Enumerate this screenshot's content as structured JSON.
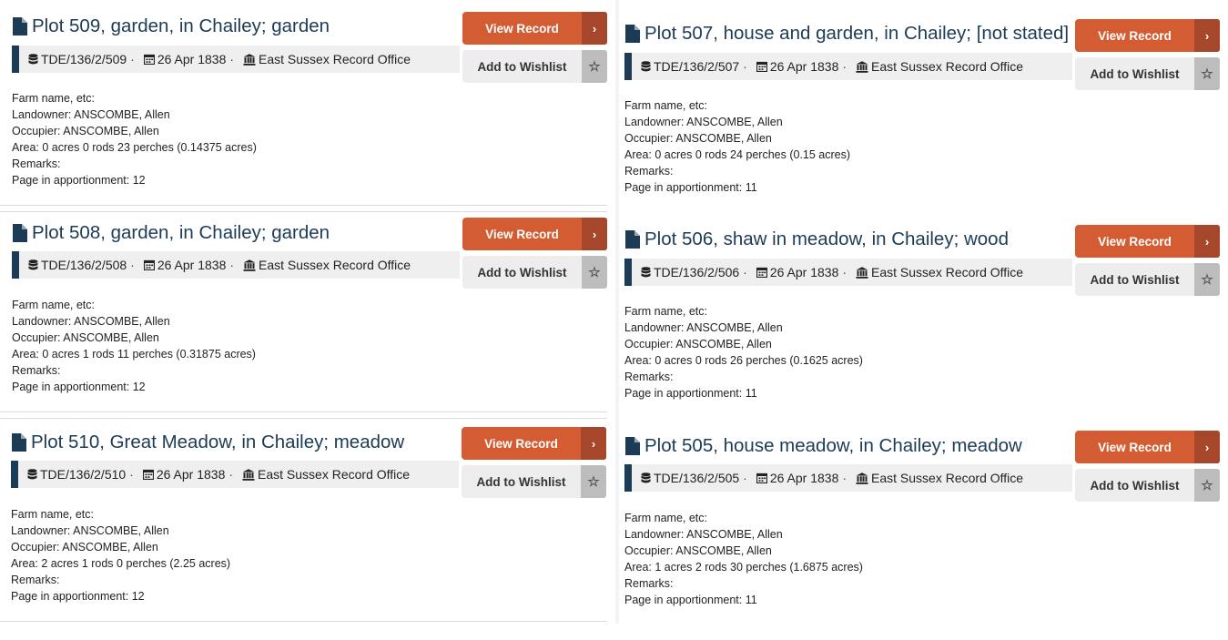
{
  "labels": {
    "view_record": "View Record",
    "add_to_wishlist": "Add to Wishlist",
    "chevron": "›",
    "star": "☆",
    "separator": "·"
  },
  "colors": {
    "title": "#1c3b57",
    "view_button": "#d45c33",
    "view_button_chevron": "#a6462a",
    "wishlist_button": "#ededed",
    "meta_bar_accent": "#1c3b57"
  },
  "icons": {
    "title": "document-icon",
    "reference": "database-icon",
    "date": "calendar-icon",
    "repository": "institution-icon"
  },
  "records": [
    {
      "title": "Plot 509, garden, in Chailey; garden",
      "reference": "TDE/136/2/509",
      "date": "26 Apr 1838",
      "repository": "East Sussex Record Office",
      "farm_name": "Farm name, etc:",
      "landowner": "Landowner: ANSCOMBE, Allen",
      "occupier": "Occupier: ANSCOMBE, Allen",
      "area": "Area: 0 acres 0 rods 23 perches (0.14375 acres)",
      "remarks": "Remarks:",
      "page": "Page in apportionment: 12"
    },
    {
      "title": "Plot 508, garden, in Chailey; garden",
      "reference": "TDE/136/2/508",
      "date": "26 Apr 1838",
      "repository": "East Sussex Record Office",
      "farm_name": "Farm name, etc:",
      "landowner": "Landowner: ANSCOMBE, Allen",
      "occupier": "Occupier: ANSCOMBE, Allen",
      "area": "Area: 0 acres 1 rods 11 perches (0.31875 acres)",
      "remarks": "Remarks:",
      "page": "Page in apportionment: 12"
    },
    {
      "title": "Plot 510, Great Meadow, in Chailey; meadow",
      "reference": "TDE/136/2/510",
      "date": "26 Apr 1838",
      "repository": "East Sussex Record Office",
      "farm_name": "Farm name, etc:",
      "landowner": "Landowner: ANSCOMBE, Allen",
      "occupier": "Occupier: ANSCOMBE, Allen",
      "area": "Area: 2 acres 1 rods 0 perches (2.25 acres)",
      "remarks": "Remarks:",
      "page": "Page in apportionment: 12"
    },
    {
      "title": "Plot 507, house and garden, in Chailey; [not stated]",
      "reference": "TDE/136/2/507",
      "date": "26 Apr 1838",
      "repository": "East Sussex Record Office",
      "farm_name": "Farm name, etc:",
      "landowner": "Landowner: ANSCOMBE, Allen",
      "occupier": "Occupier: ANSCOMBE, Allen",
      "area": "Area: 0 acres 0 rods 24 perches (0.15 acres)",
      "remarks": "Remarks:",
      "page": "Page in apportionment: 11"
    },
    {
      "title": "Plot 506, shaw in meadow, in Chailey; wood",
      "reference": "TDE/136/2/506",
      "date": "26 Apr 1838",
      "repository": "East Sussex Record Office",
      "farm_name": "Farm name, etc:",
      "landowner": "Landowner: ANSCOMBE, Allen",
      "occupier": "Occupier: ANSCOMBE, Allen",
      "area": "Area: 0 acres 0 rods 26 perches (0.1625 acres)",
      "remarks": "Remarks:",
      "page": "Page in apportionment: 11"
    },
    {
      "title": "Plot 505, house meadow, in Chailey; meadow",
      "reference": "TDE/136/2/505",
      "date": "26 Apr 1838",
      "repository": "East Sussex Record Office",
      "farm_name": "Farm name, etc:",
      "landowner": "Landowner: ANSCOMBE, Allen",
      "occupier": "Occupier: ANSCOMBE, Allen",
      "area": "Area: 1 acres 2 rods 30 perches (1.6875 acres)",
      "remarks": "Remarks:",
      "page": "Page in apportionment: 11"
    }
  ]
}
